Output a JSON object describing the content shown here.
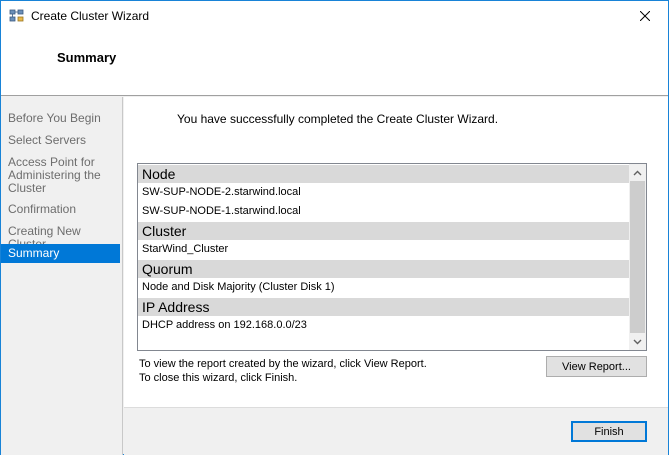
{
  "window": {
    "title": "Create Cluster Wizard",
    "icon": "cluster-wizard-icon"
  },
  "header": {
    "title": "Summary"
  },
  "sidebar": {
    "items": [
      {
        "label": "Before You Begin",
        "active": false
      },
      {
        "label": "Select Servers",
        "active": false
      },
      {
        "label": "Access Point for Administering the Cluster",
        "active": false
      },
      {
        "label": "Confirmation",
        "active": false
      },
      {
        "label": "Creating New Cluster",
        "active": false
      },
      {
        "label": "Summary",
        "active": true
      }
    ]
  },
  "main": {
    "success_message": "You have successfully completed the Create Cluster Wizard.",
    "report_sections": [
      {
        "heading": "Node",
        "items": [
          "SW-SUP-NODE-2.starwind.local",
          "SW-SUP-NODE-1.starwind.local"
        ]
      },
      {
        "heading": "Cluster",
        "items": [
          "StarWind_Cluster"
        ]
      },
      {
        "heading": "Quorum",
        "items": [
          "Node and Disk Majority (Cluster Disk 1)"
        ]
      },
      {
        "heading": "IP Address",
        "items": [
          "DHCP address on 192.168.0.0/23"
        ]
      }
    ],
    "hint_view_report": "To view the report created by the wizard, click View Report.",
    "hint_finish": "To close this wizard, click Finish.",
    "view_report_label": "View Report...",
    "finish_label": "Finish"
  },
  "colors": {
    "accent": "#0078d7",
    "window_border": "#1883d7",
    "section_header": "#d9d9d9"
  }
}
